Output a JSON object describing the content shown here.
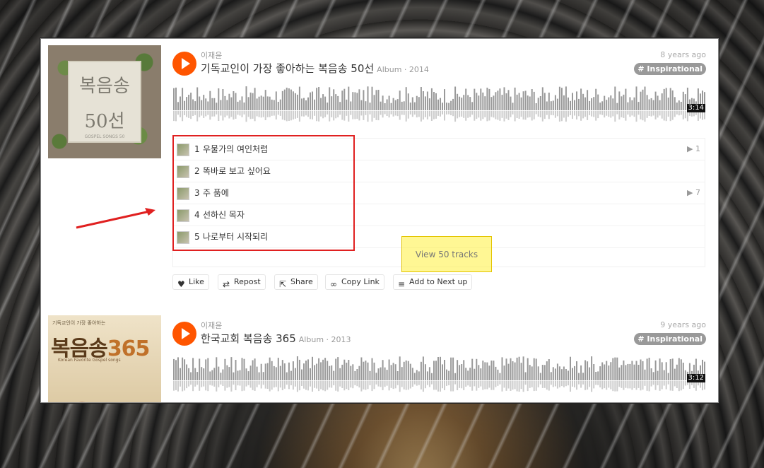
{
  "items": [
    {
      "artist": "이재윤",
      "title": "기독교인이 가장 좋아하는 복음송 50선",
      "type_year": "Album · 2014",
      "age": "8 years ago",
      "tag": "# Inspirational",
      "duration": "3:14",
      "cover": {
        "big_line1": "복음송",
        "big_line2": "50선",
        "small": "GOSPEL SONGS 50"
      },
      "tracks": [
        {
          "num": "1",
          "name": "우물가의 여인처럼",
          "plays": "▶ 1"
        },
        {
          "num": "2",
          "name": "똑바로 보고 싶어요",
          "plays": ""
        },
        {
          "num": "3",
          "name": "주 품에",
          "plays": "▶ 7"
        },
        {
          "num": "4",
          "name": "선하신 목자",
          "plays": ""
        },
        {
          "num": "5",
          "name": "나로부터 시작되리",
          "plays": ""
        }
      ],
      "view_all": "View 50 tracks",
      "actions": {
        "like": "Like",
        "repost": "Repost",
        "share": "Share",
        "copy_link": "Copy Link",
        "next_up": "Add to Next up"
      }
    },
    {
      "artist": "이재윤",
      "title": "한국교회 복음송 365",
      "type_year": "Album · 2013",
      "age": "9 years ago",
      "tag": "# Inspirational",
      "duration": "3:12",
      "cover": {
        "top": "기독교인이 가장 좋아하는",
        "big": "복음송",
        "big_num": "365",
        "sub": "Korean Favorite Gospel songs"
      }
    }
  ],
  "colors": {
    "accent": "#ff5500",
    "tag": "#999999",
    "annotation_red": "#e02020",
    "highlight": "#fff03c"
  }
}
